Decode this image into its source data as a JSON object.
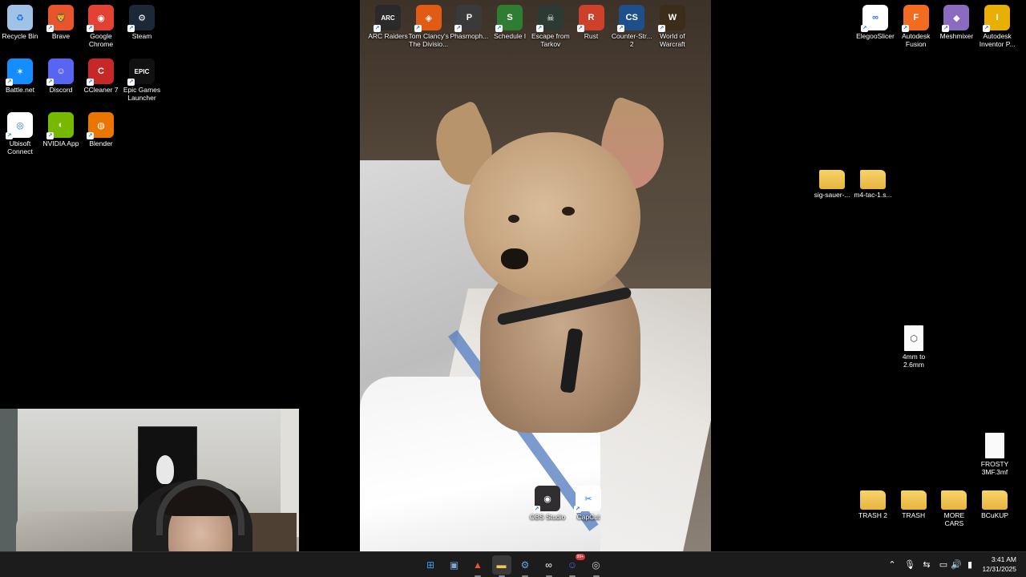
{
  "desktop": {
    "left_icons": [
      {
        "label": "Recycle Bin",
        "icon": "recycle-bin-icon",
        "color": "#9fc2e6",
        "glyph": "♻"
      },
      {
        "label": "Brave",
        "icon": "brave-icon",
        "color": "#e8552d",
        "glyph": "🦁"
      },
      {
        "label": "Google Chrome",
        "icon": "chrome-icon",
        "color": "#e34133",
        "glyph": "◉"
      },
      {
        "label": "Steam",
        "icon": "steam-icon",
        "color": "#1b2838",
        "glyph": "⚙"
      },
      {
        "label": "Battle.net",
        "icon": "battlenet-icon",
        "color": "#148eff",
        "glyph": "✶"
      },
      {
        "label": "Discord",
        "icon": "discord-icon",
        "color": "#5865f2",
        "glyph": "☺"
      },
      {
        "label": "CCleaner 7",
        "icon": "ccleaner-icon",
        "color": "#c62828",
        "glyph": "C"
      },
      {
        "label": "Epic Games Launcher",
        "icon": "epic-games-icon",
        "color": "#111111",
        "glyph": "EPIC"
      },
      {
        "label": "Ubisoft Connect",
        "icon": "ubisoft-icon",
        "color": "#ffffff",
        "glyph": "◎"
      },
      {
        "label": "NVIDIA App",
        "icon": "nvidia-icon",
        "color": "#76b900",
        "glyph": "◐"
      },
      {
        "label": "Blender",
        "icon": "blender-icon",
        "color": "#ea7600",
        "glyph": "◍"
      }
    ],
    "top_icons": [
      {
        "label": "ARC Raiders",
        "icon": "arc-raiders-icon",
        "color": "#2a2a2a",
        "glyph": "ARC"
      },
      {
        "label": "Tom Clancy's The Divisio...",
        "icon": "division-icon",
        "color": "#e25b14",
        "glyph": "◈"
      },
      {
        "label": "Phasmoph...",
        "icon": "phasmophobia-icon",
        "color": "#3a3a3a",
        "glyph": "P"
      },
      {
        "label": "Schedule I",
        "icon": "schedule-icon",
        "color": "#2e7d32",
        "glyph": "S"
      },
      {
        "label": "Escape from Tarkov",
        "icon": "tarkov-icon",
        "color": "#2c3a33",
        "glyph": "☠"
      },
      {
        "label": "Rust",
        "icon": "rust-icon",
        "color": "#cd412b",
        "glyph": "R"
      },
      {
        "label": "Counter-Str... 2",
        "icon": "counter-strike-icon",
        "color": "#1f4f8b",
        "glyph": "CS"
      },
      {
        "label": "World of Warcraft",
        "icon": "wow-icon",
        "color": "#3b2d1a",
        "glyph": "W"
      }
    ],
    "right_icons": [
      {
        "label": "ElegooSlicer",
        "icon": "elegoo-slicer-icon",
        "color": "#ffffff",
        "glyph": "∞"
      },
      {
        "label": "Autodesk Fusion",
        "icon": "autodesk-fusion-icon",
        "color": "#f26b20",
        "glyph": "F"
      },
      {
        "label": "Meshmixer",
        "icon": "meshmixer-icon",
        "color": "#8a6bbf",
        "glyph": "◆"
      },
      {
        "label": "Autodesk Inventor P...",
        "icon": "autodesk-inventor-icon",
        "color": "#e8b007",
        "glyph": "I"
      }
    ],
    "folders": [
      {
        "label": "sig-sauer-...",
        "icon": "folder-icon"
      },
      {
        "label": "m4-tac-1.s...",
        "icon": "folder-icon"
      }
    ],
    "file_3d": {
      "label": "4mm to 2.6mm",
      "icon": "3d-model-file-icon"
    },
    "file_frosty": {
      "label": "FROSTY 3MF.3mf",
      "icon": "file-icon"
    },
    "bottom_folders": [
      {
        "label": "TRASH 2",
        "icon": "folder-icon"
      },
      {
        "label": "TRASH",
        "icon": "folder-icon"
      },
      {
        "label": "MORE CARS",
        "icon": "folder-icon"
      },
      {
        "label": "BCuKUP",
        "icon": "folder-icon"
      }
    ],
    "wallpaper_icons": [
      {
        "label": "OBS Studio",
        "icon": "obs-icon",
        "color": "#302e31",
        "glyph": "◉"
      },
      {
        "label": "CapCut",
        "icon": "capcut-icon",
        "color": "#ffffff",
        "glyph": "✂"
      }
    ]
  },
  "taskbar": {
    "apps": [
      {
        "name": "start-button",
        "glyph": "⊞",
        "color": "#3b9bf2"
      },
      {
        "name": "taskbar-app-1",
        "glyph": "▣",
        "color": "#7aa6d6"
      },
      {
        "name": "taskbar-brave",
        "glyph": "▲",
        "color": "#e8552d"
      },
      {
        "name": "taskbar-file-explorer",
        "glyph": "▬",
        "color": "#f5c84c"
      },
      {
        "name": "taskbar-steam",
        "glyph": "⚙",
        "color": "#6aa6d6"
      },
      {
        "name": "taskbar-elegoo",
        "glyph": "∞",
        "color": "#ffffff"
      },
      {
        "name": "taskbar-discord",
        "glyph": "☺",
        "color": "#5865f2"
      },
      {
        "name": "taskbar-app-8",
        "glyph": "◎",
        "color": "#cccccc"
      }
    ],
    "discord_badge": "99+",
    "tray_icons": [
      "chevron-up-icon",
      "microphone-icon",
      "network-share-icon",
      "display-icon",
      "volume-icon",
      "battery-icon"
    ],
    "time": "3:41 AM",
    "date": "12/31/2025"
  }
}
